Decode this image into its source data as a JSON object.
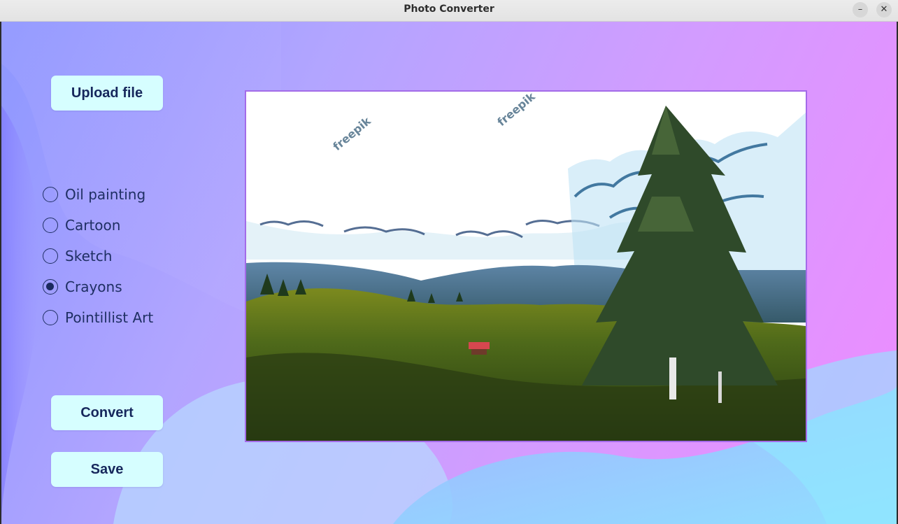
{
  "window": {
    "title": "Photo Converter",
    "minimize": "–",
    "close": "✕"
  },
  "buttons": {
    "upload": "Upload file",
    "convert": "Convert",
    "save": "Save"
  },
  "styles": {
    "selected": "Crayons",
    "options": [
      "Oil painting",
      "Cartoon",
      "Sketch",
      "Crayons",
      "Pointillist Art"
    ]
  },
  "preview": {
    "description_icon": "landscape-image",
    "watermark": "freepik"
  },
  "colors": {
    "button_bg": "#d6feff",
    "button_text": "#16275c",
    "frame_border": "#a36be8",
    "radio": "#1f2f63"
  }
}
